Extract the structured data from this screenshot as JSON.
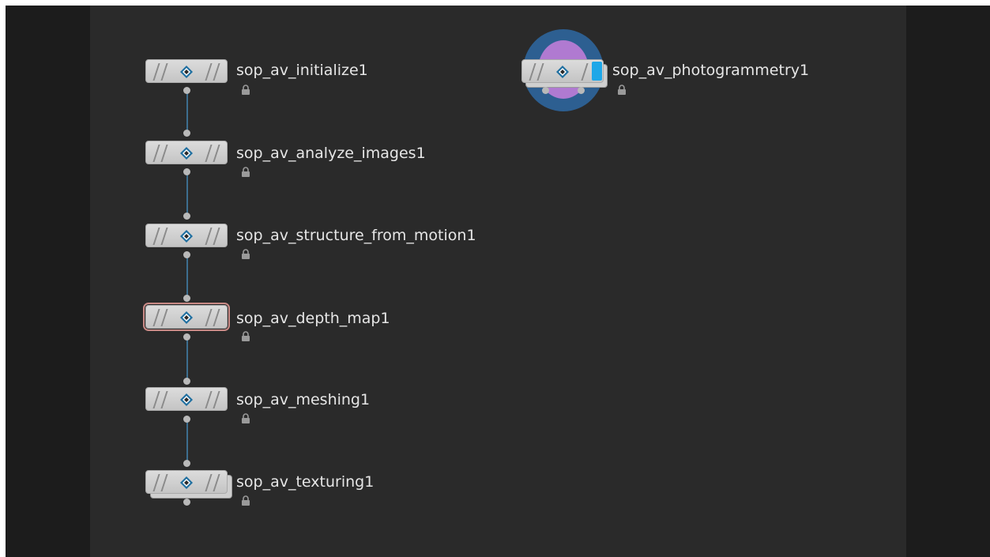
{
  "network": {
    "nodes": [
      {
        "name": "sop_av_initialize1",
        "locked": true
      },
      {
        "name": "sop_av_analyze_images1",
        "locked": true
      },
      {
        "name": "sop_av_structure_from_motion1",
        "locked": true
      },
      {
        "name": "sop_av_depth_map1",
        "locked": true,
        "selected": true
      },
      {
        "name": "sop_av_meshing1",
        "locked": true
      },
      {
        "name": "sop_av_texturing1",
        "locked": true
      },
      {
        "name": "sop_av_photogrammetry1",
        "locked": true
      }
    ]
  },
  "colors": {
    "canvas": "#2a2a2a",
    "wire": "#3c6e8f",
    "badge_outer": "#2d5f91",
    "badge_inner": "#b07ad1",
    "display_flag": "#1ea7e8"
  },
  "icons": {
    "node_icon": "diamond-gem-icon",
    "lock_icon": "lock-icon",
    "connector": "connector-dot-icon"
  }
}
